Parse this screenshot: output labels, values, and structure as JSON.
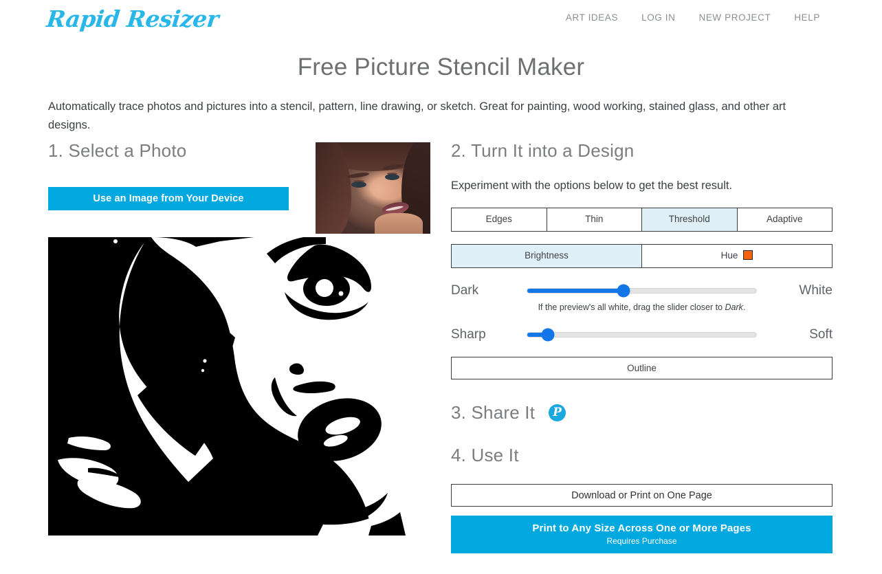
{
  "header": {
    "logo": "Rapid Resizer",
    "nav": [
      {
        "label": "ART IDEAS"
      },
      {
        "label": "LOG IN"
      },
      {
        "label": "NEW PROJECT"
      },
      {
        "label": "HELP"
      }
    ]
  },
  "page": {
    "title": "Free Picture Stencil Maker",
    "intro": "Automatically trace photos and pictures into a stencil, pattern, line drawing, or sketch. Great for painting, wood working, stained glass, and other art designs."
  },
  "step1": {
    "heading": "1. Select a Photo",
    "upload_button": "Use an Image from Your Device"
  },
  "step2": {
    "heading": "2. Turn It into a Design",
    "note": "Experiment with the options below to get the best result.",
    "mode_tabs": [
      {
        "label": "Edges",
        "selected": false
      },
      {
        "label": "Thin",
        "selected": false
      },
      {
        "label": "Threshold",
        "selected": true
      },
      {
        "label": "Adaptive",
        "selected": false
      }
    ],
    "channel_tabs": [
      {
        "label": "Brightness",
        "selected": true
      },
      {
        "label": "Hue",
        "selected": false,
        "swatch_color": "#f4620f"
      }
    ],
    "sliders": [
      {
        "name": "brightness",
        "left_label": "Dark",
        "right_label": "White",
        "value_percent": 42,
        "hint_before": "If the preview's all white, drag the slider closer to ",
        "hint_italic": "Dark",
        "hint_after": "."
      },
      {
        "name": "sharpness",
        "left_label": "Sharp",
        "right_label": "Soft",
        "value_percent": 9
      }
    ],
    "outline_button": "Outline"
  },
  "step3": {
    "heading": "3. Share It",
    "pinterest_glyph": "P"
  },
  "step4": {
    "heading": "4. Use It",
    "download_button": "Download or Print on One Page",
    "print_button": "Print to Any Size Across One or More Pages",
    "print_button_sub": "Requires Purchase"
  },
  "colors": {
    "brand_blue": "#00a8e0",
    "logo_blue": "#29b6e8",
    "tab_selected": "#dff0f8",
    "slider_blue": "#1275e8",
    "hue_swatch": "#f4620f"
  }
}
